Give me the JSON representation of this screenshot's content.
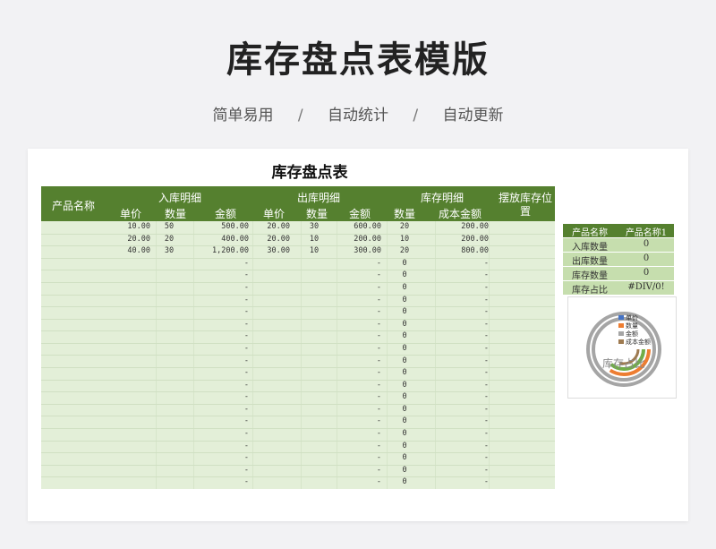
{
  "page": {
    "title": "库存盘点表模版",
    "subtitle_items": [
      "简单易用",
      "自动统计",
      "自动更新"
    ],
    "separator": "/"
  },
  "sheet": {
    "title": "库存盘点表",
    "headers": {
      "product_name": "产品名称",
      "in_group": "入库明细",
      "out_group": "出库明细",
      "stock_group": "库存明细",
      "location": "摆放库存位置",
      "unit_price": "单价",
      "quantity": "数量",
      "amount": "金额",
      "cost_amount": "成本金额"
    },
    "rows": [
      {
        "in_price": "10.00",
        "in_qty": "50",
        "in_amount": "500.00",
        "out_price": "20.00",
        "out_qty": "30",
        "out_amount": "600.00",
        "stock_qty": "20",
        "cost": "200.00"
      },
      {
        "in_price": "20.00",
        "in_qty": "20",
        "in_amount": "400.00",
        "out_price": "20.00",
        "out_qty": "10",
        "out_amount": "200.00",
        "stock_qty": "10",
        "cost": "200.00"
      },
      {
        "in_price": "40.00",
        "in_qty": "30",
        "in_amount": "1,200.00",
        "out_price": "30.00",
        "out_qty": "10",
        "out_amount": "300.00",
        "stock_qty": "20",
        "cost": "800.00"
      }
    ],
    "empty_dash": "-",
    "empty_zero": "0",
    "empty_row_count": 19
  },
  "summary": {
    "header_label": "产品名称",
    "header_value": "产品名称1",
    "rows": [
      {
        "label": "入库数量",
        "value": "0"
      },
      {
        "label": "出库数量",
        "value": "0"
      },
      {
        "label": "库存数量",
        "value": "0"
      },
      {
        "label": "库存占比",
        "value": "#DIV/0!"
      }
    ]
  },
  "chart": {
    "title": "库存占比",
    "legend": [
      "单价",
      "数量",
      "金额",
      "成本金额"
    ],
    "colors": {
      "header": "#55802f",
      "body": "#e3efd8",
      "side": "#c6deae",
      "ring1": "#4472c4",
      "ring2": "#ed7d31",
      "ring3": "#a5a5a5",
      "ring4": "#70ad47",
      "ring5": "#9e7a50"
    }
  }
}
